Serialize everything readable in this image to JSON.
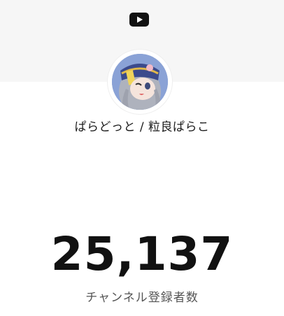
{
  "header": {
    "logo_icon": "youtube-icon"
  },
  "channel": {
    "avatar_icon": "channel-avatar",
    "name": "ぱらどっと / 粒良ぱらこ"
  },
  "stats": {
    "subscriber_count": "25,137",
    "subscriber_label": "チャンネル登録者数"
  },
  "colors": {
    "youtube": "#111111",
    "band": "#f6f6f6",
    "text": "#111111",
    "label": "#555555"
  }
}
